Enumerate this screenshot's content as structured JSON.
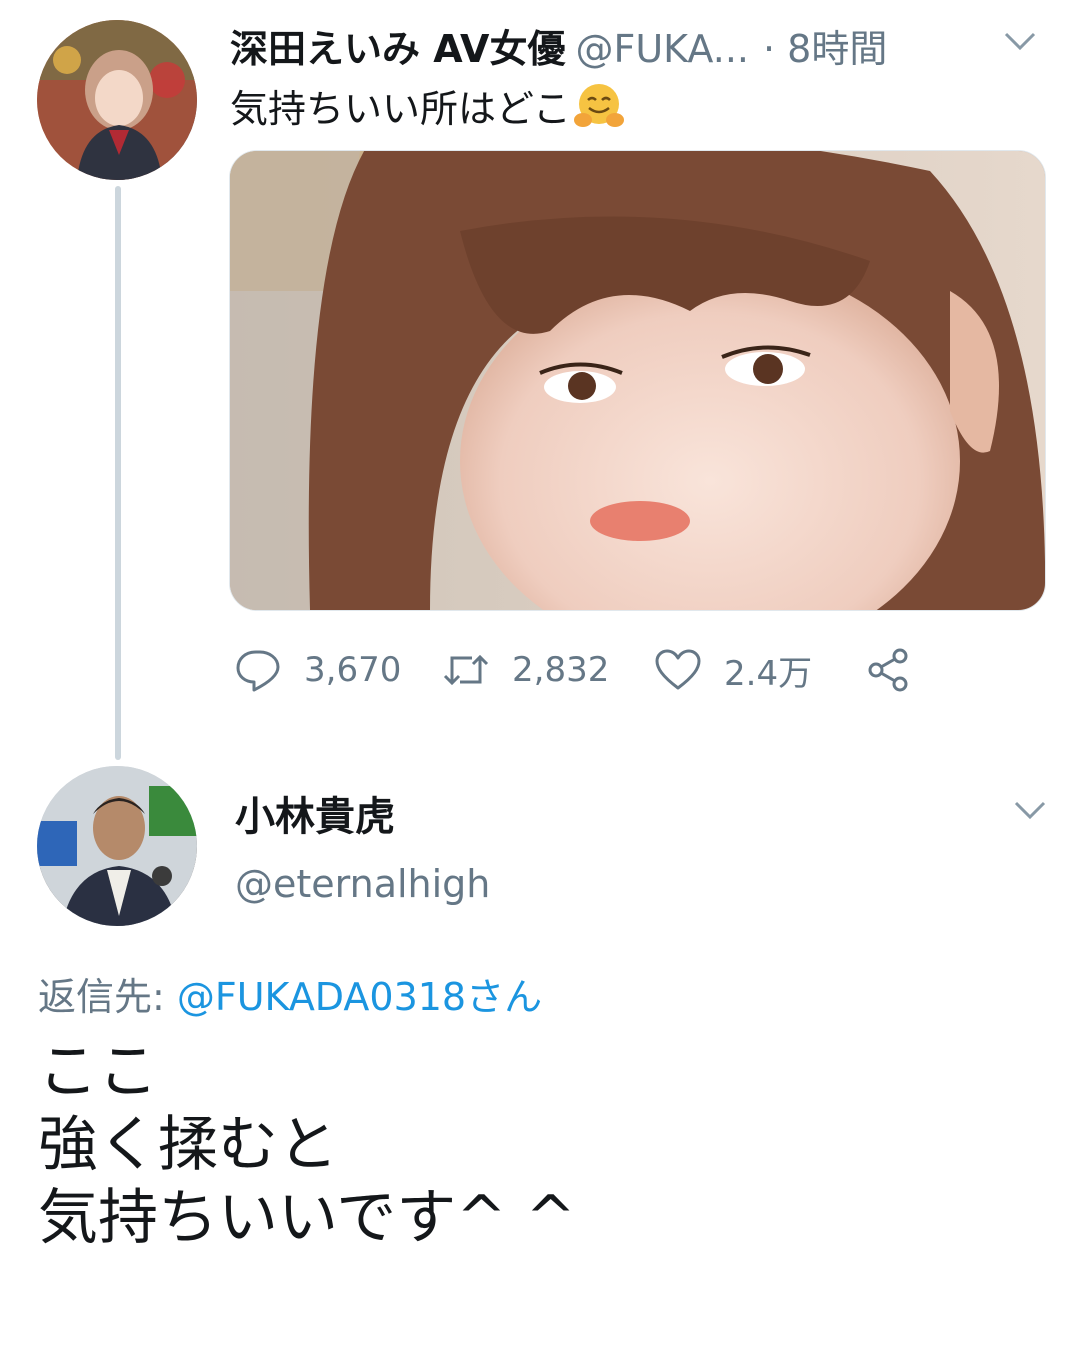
{
  "tweet": {
    "author_name": "深田えいみ AV女優",
    "author_handle": "@FUKA...",
    "time": "· 8時間",
    "text": "気持ちいい所はどこ",
    "emoji_icon": "hugging-face-emoji",
    "stats": {
      "replies": "3,670",
      "retweets": "2,832",
      "likes": "2.4万"
    }
  },
  "reply": {
    "author_name": "小林貴虎",
    "author_handle": "@eternalhigh",
    "reply_to_label": "返信先: ",
    "reply_to_handle": "@FUKADA0318さん",
    "lines": [
      "ここ",
      "強く揉むと",
      "気持ちいいです^ ^"
    ]
  },
  "icons": {
    "reply": "reply-icon",
    "retweet": "retweet-icon",
    "like": "heart-icon",
    "share": "share-icon",
    "menu": "chevron-down-icon"
  },
  "colors": {
    "text": "#14171a",
    "secondary": "#657786",
    "link": "#1b95e0",
    "thread_line": "#ccd6dd"
  }
}
